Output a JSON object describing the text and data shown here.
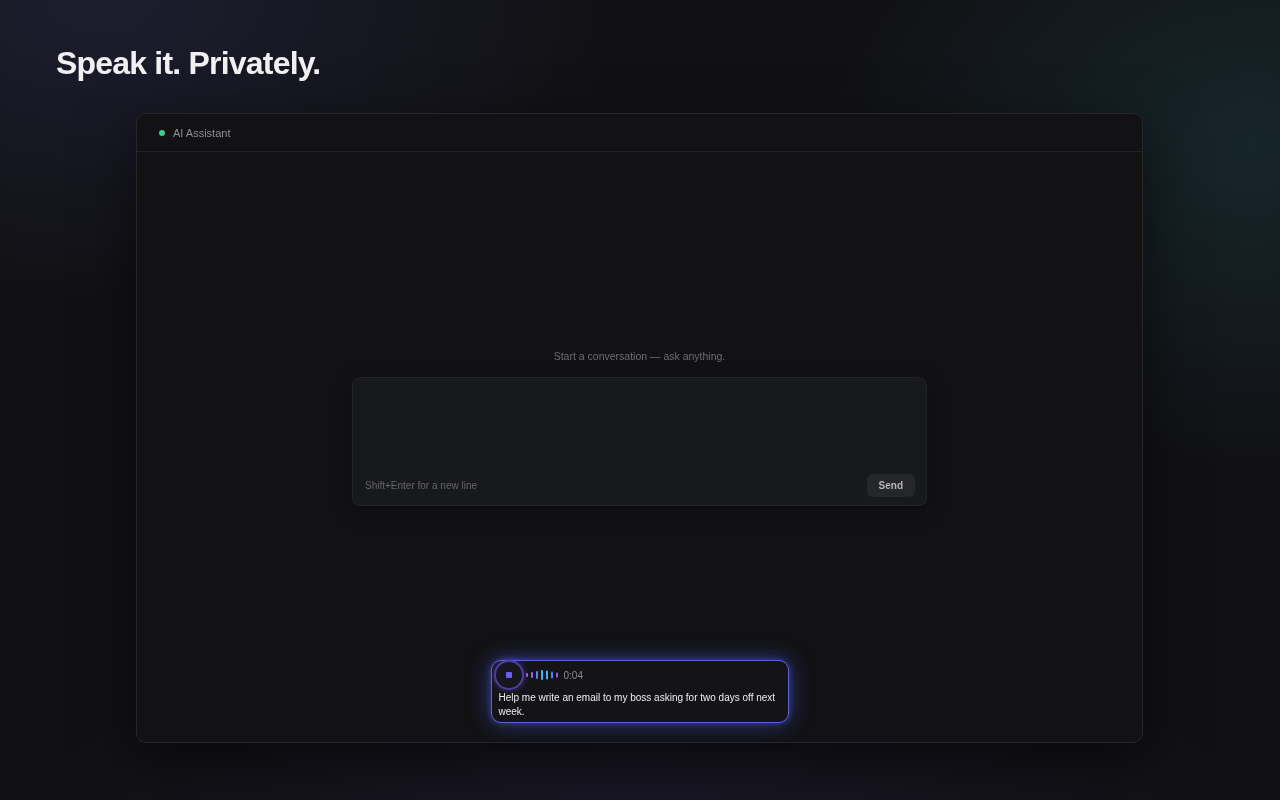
{
  "headline": "Speak it. Privately.",
  "window": {
    "title": "AI Assistant",
    "online": true
  },
  "empty_state": "Start a conversation — ask anything.",
  "composer": {
    "hint": "Shift+Enter for a new line",
    "send_button": "Send"
  },
  "recorder": {
    "recording": true,
    "timer": "0:04",
    "transcript": "Help me write an email to my boss asking for two days off next week."
  }
}
